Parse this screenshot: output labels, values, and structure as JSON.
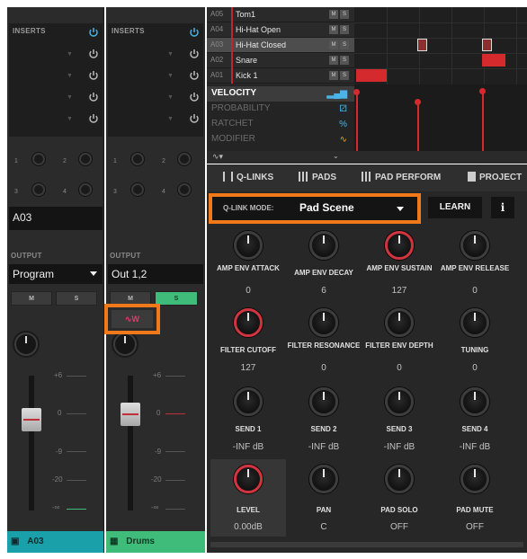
{
  "colors": {
    "accent_orange": "#f07a1a",
    "red": "#d42a2e",
    "teal": "#1aa0a8",
    "green": "#3fbb7a",
    "power_blue": "#4ab4e8"
  },
  "strips": [
    {
      "inserts_label": "INSERTS",
      "knob_numbers": [
        "1",
        "2",
        "3",
        "4"
      ],
      "track_name": "A03",
      "output_label": "OUTPUT",
      "output_value": "Program",
      "mute_label": "M",
      "solo_label": "S",
      "meter_labels": [
        "+6",
        "0",
        "-9",
        "-20",
        "-∞"
      ],
      "footer": "A03",
      "footer_icon": "pad-icon"
    },
    {
      "inserts_label": "INSERTS",
      "knob_numbers": [
        "1",
        "2",
        "3",
        "4"
      ],
      "track_name": "",
      "output_label": "OUTPUT",
      "output_value": "Out 1,2",
      "mute_label": "M",
      "solo_label": "S",
      "automation_label": "W",
      "meter_labels": [
        "+6",
        "0",
        "-9",
        "-20",
        "-∞"
      ],
      "footer": "Drums",
      "footer_icon": "grid-icon"
    }
  ],
  "pads": [
    {
      "id": "A05",
      "name": "Tom1"
    },
    {
      "id": "A04",
      "name": "Hi-Hat Open"
    },
    {
      "id": "A03",
      "name": "Hi-Hat Closed"
    },
    {
      "id": "A02",
      "name": "Snare"
    },
    {
      "id": "A01",
      "name": "Kick 1"
    }
  ],
  "pad_buttons": {
    "mute": "M",
    "solo": "S"
  },
  "lanes": [
    {
      "label": "VELOCITY",
      "icon": "bars-icon"
    },
    {
      "label": "PROBABILITY",
      "icon": "dice-icon"
    },
    {
      "label": "RATCHET",
      "icon": "percent-icon"
    },
    {
      "label": "MODIFIER",
      "icon": "curve-icon"
    }
  ],
  "tabs": [
    {
      "label": "Q-LINKS",
      "icon": "sliders-icon"
    },
    {
      "label": "PADS",
      "icon": "grid-icon"
    },
    {
      "label": "PAD PERFORM",
      "icon": "grid-icon"
    },
    {
      "label": "PROJECT",
      "icon": "document-icon"
    }
  ],
  "qlink_mode": {
    "label": "Q-LINK MODE:",
    "value": "Pad Scene"
  },
  "learn_label": "LEARN",
  "info_label": "i",
  "qlinks": [
    {
      "name": "AMP ENV ATTACK",
      "value": "0"
    },
    {
      "name": "AMP ENV DECAY",
      "value": "6"
    },
    {
      "name": "AMP ENV SUSTAIN",
      "value": "127"
    },
    {
      "name": "AMP ENV RELEASE",
      "value": "0"
    },
    {
      "name": "FILTER CUTOFF",
      "value": "127"
    },
    {
      "name": "FILTER RESONANCE",
      "value": "0"
    },
    {
      "name": "FILTER ENV DEPTH",
      "value": "0"
    },
    {
      "name": "TUNING",
      "value": "0"
    },
    {
      "name": "SEND 1",
      "value": "-INF dB"
    },
    {
      "name": "SEND 2",
      "value": "-INF dB"
    },
    {
      "name": "SEND 3",
      "value": "-INF dB"
    },
    {
      "name": "SEND 4",
      "value": "-INF dB"
    },
    {
      "name": "LEVEL",
      "value": "0.00dB"
    },
    {
      "name": "PAN",
      "value": "C"
    },
    {
      "name": "PAD SOLO",
      "value": "OFF"
    },
    {
      "name": "PAD MUTE",
      "value": "OFF"
    }
  ]
}
